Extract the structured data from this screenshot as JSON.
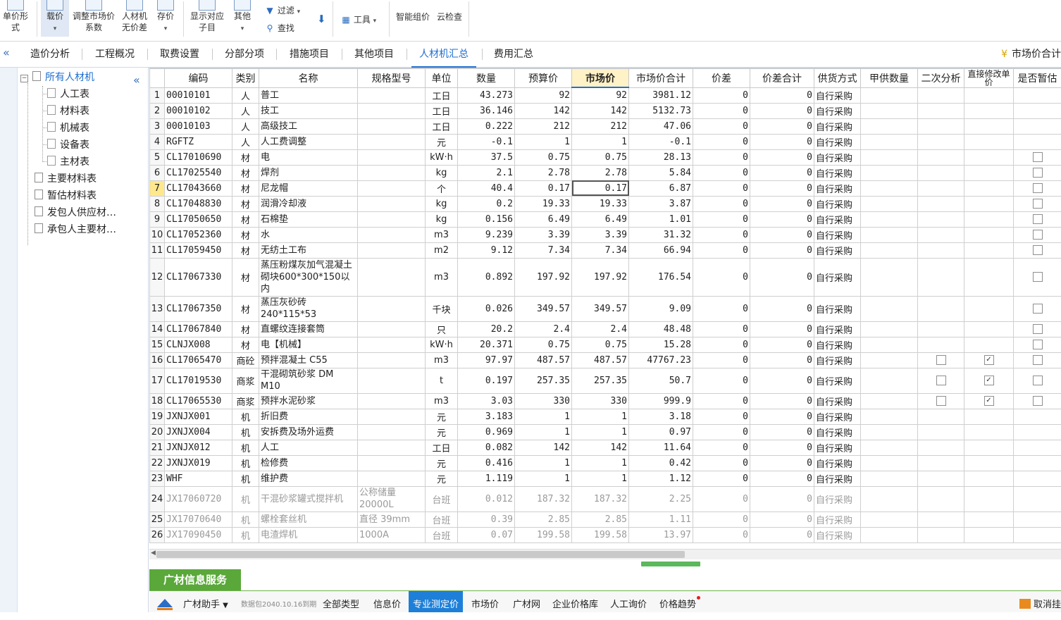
{
  "ribbon": {
    "unit_price_form": "单价形式",
    "zaijia": "载价",
    "adjust_market_1": "调整市场价",
    "adjust_market_2": "系数",
    "rcj_nodiff_1": "人材机",
    "rcj_nodiff_2": "无价差",
    "save_price": "存价",
    "show_sub_1": "显示对应",
    "show_sub_2": "子目",
    "other": "其他",
    "filter": "过滤",
    "find": "查找",
    "tools": "工具",
    "smart_price": "智能组价",
    "cloud_check": "云检查"
  },
  "tabs": {
    "items": [
      "造价分析",
      "工程概况",
      "取费设置",
      "分部分项",
      "措施项目",
      "其他项目",
      "人材机汇总",
      "费用汇总"
    ],
    "active": "人材机汇总",
    "market_total": "市场价合计"
  },
  "tree": {
    "root": "所有人材机",
    "children": [
      "人工表",
      "材料表",
      "机械表",
      "设备表",
      "主材表"
    ],
    "groups": [
      "主要材料表",
      "暂估材料表",
      "发包人供应材…",
      "承包人主要材…"
    ]
  },
  "grid": {
    "columns": [
      "编码",
      "类别",
      "名称",
      "规格型号",
      "单位",
      "数量",
      "预算价",
      "市场价",
      "市场价合计",
      "价差",
      "价差合计",
      "供货方式",
      "甲供数量",
      "二次分析",
      "直接修改单价",
      "是否暂估"
    ],
    "rows": [
      {
        "n": "1",
        "code": "00010101",
        "cat": "人",
        "name": "普工",
        "spec": "",
        "unit": "工日",
        "qty": "43.273",
        "budget": "92",
        "market": "92",
        "total": "3981.12",
        "diff": "0",
        "difft": "0",
        "supply": "自行采购",
        "a2": null,
        "direct": null,
        "temp": null
      },
      {
        "n": "2",
        "code": "00010102",
        "cat": "人",
        "name": "技工",
        "spec": "",
        "unit": "工日",
        "qty": "36.146",
        "budget": "142",
        "market": "142",
        "total": "5132.73",
        "diff": "0",
        "difft": "0",
        "supply": "自行采购",
        "a2": null,
        "direct": null,
        "temp": null
      },
      {
        "n": "3",
        "code": "00010103",
        "cat": "人",
        "name": "高级技工",
        "spec": "",
        "unit": "工日",
        "qty": "0.222",
        "budget": "212",
        "market": "212",
        "total": "47.06",
        "diff": "0",
        "difft": "0",
        "supply": "自行采购",
        "a2": null,
        "direct": null,
        "temp": null
      },
      {
        "n": "4",
        "code": "RGFTZ",
        "cat": "人",
        "name": "人工费调整",
        "spec": "",
        "unit": "元",
        "qty": "-0.1",
        "budget": "1",
        "market": "1",
        "total": "-0.1",
        "diff": "0",
        "difft": "0",
        "supply": "自行采购",
        "a2": null,
        "direct": null,
        "temp": null
      },
      {
        "n": "5",
        "code": "CL17010690",
        "cat": "材",
        "name": "电",
        "spec": "",
        "unit": "kW·h",
        "qty": "37.5",
        "budget": "0.75",
        "market": "0.75",
        "total": "28.13",
        "diff": "0",
        "difft": "0",
        "supply": "自行采购",
        "a2": null,
        "direct": null,
        "temp": false
      },
      {
        "n": "6",
        "code": "CL17025540",
        "cat": "材",
        "name": "焊剂",
        "spec": "",
        "unit": "kg",
        "qty": "2.1",
        "budget": "2.78",
        "market": "2.78",
        "total": "5.84",
        "diff": "0",
        "difft": "0",
        "supply": "自行采购",
        "a2": null,
        "direct": null,
        "temp": false
      },
      {
        "n": "7",
        "code": "CL17043660",
        "cat": "材",
        "name": "尼龙帽",
        "spec": "",
        "unit": "个",
        "qty": "40.4",
        "budget": "0.17",
        "market": "0.17",
        "total": "6.87",
        "diff": "0",
        "difft": "0",
        "supply": "自行采购",
        "a2": null,
        "direct": null,
        "temp": false,
        "current": true
      },
      {
        "n": "8",
        "code": "CL17048830",
        "cat": "材",
        "name": "润滑冷却液",
        "spec": "",
        "unit": "kg",
        "qty": "0.2",
        "budget": "19.33",
        "market": "19.33",
        "total": "3.87",
        "diff": "0",
        "difft": "0",
        "supply": "自行采购",
        "a2": null,
        "direct": null,
        "temp": false
      },
      {
        "n": "9",
        "code": "CL17050650",
        "cat": "材",
        "name": "石棉垫",
        "spec": "",
        "unit": "kg",
        "qty": "0.156",
        "budget": "6.49",
        "market": "6.49",
        "total": "1.01",
        "diff": "0",
        "difft": "0",
        "supply": "自行采购",
        "a2": null,
        "direct": null,
        "temp": false
      },
      {
        "n": "10",
        "code": "CL17052360",
        "cat": "材",
        "name": "水",
        "spec": "",
        "unit": "m3",
        "qty": "9.239",
        "budget": "3.39",
        "market": "3.39",
        "total": "31.32",
        "diff": "0",
        "difft": "0",
        "supply": "自行采购",
        "a2": null,
        "direct": null,
        "temp": false
      },
      {
        "n": "11",
        "code": "CL17059450",
        "cat": "材",
        "name": "无纺土工布",
        "spec": "",
        "unit": "m2",
        "qty": "9.12",
        "budget": "7.34",
        "market": "7.34",
        "total": "66.94",
        "diff": "0",
        "difft": "0",
        "supply": "自行采购",
        "a2": null,
        "direct": null,
        "temp": false
      },
      {
        "n": "12",
        "code": "CL17067330",
        "cat": "材",
        "name": "蒸压粉煤灰加气混凝土砌块600*300*150以内",
        "spec": "",
        "unit": "m3",
        "qty": "0.892",
        "budget": "197.92",
        "market": "197.92",
        "total": "176.54",
        "diff": "0",
        "difft": "0",
        "supply": "自行采购",
        "a2": null,
        "direct": null,
        "temp": false
      },
      {
        "n": "13",
        "code": "CL17067350",
        "cat": "材",
        "name": "蒸压灰砂砖240*115*53",
        "spec": "",
        "unit": "千块",
        "qty": "0.026",
        "budget": "349.57",
        "market": "349.57",
        "total": "9.09",
        "diff": "0",
        "difft": "0",
        "supply": "自行采购",
        "a2": null,
        "direct": null,
        "temp": false
      },
      {
        "n": "14",
        "code": "CL17067840",
        "cat": "材",
        "name": "直螺纹连接套筒",
        "spec": "",
        "unit": "只",
        "qty": "20.2",
        "budget": "2.4",
        "market": "2.4",
        "total": "48.48",
        "diff": "0",
        "difft": "0",
        "supply": "自行采购",
        "a2": null,
        "direct": null,
        "temp": false
      },
      {
        "n": "15",
        "code": "CLNJX008",
        "cat": "材",
        "name": "电【机械】",
        "spec": "",
        "unit": "kW·h",
        "qty": "20.371",
        "budget": "0.75",
        "market": "0.75",
        "total": "15.28",
        "diff": "0",
        "difft": "0",
        "supply": "自行采购",
        "a2": null,
        "direct": null,
        "temp": false
      },
      {
        "n": "16",
        "code": "CL17065470",
        "cat": "商砼",
        "name": "预拌混凝土 C55",
        "spec": "",
        "unit": "m3",
        "qty": "97.97",
        "budget": "487.57",
        "market": "487.57",
        "total": "47767.23",
        "diff": "0",
        "difft": "0",
        "supply": "自行采购",
        "a2": false,
        "direct": true,
        "temp": false
      },
      {
        "n": "17",
        "code": "CL17019530",
        "cat": "商浆",
        "name": "干混砌筑砂浆 DM M10",
        "spec": "",
        "unit": "t",
        "qty": "0.197",
        "budget": "257.35",
        "market": "257.35",
        "total": "50.7",
        "diff": "0",
        "difft": "0",
        "supply": "自行采购",
        "a2": false,
        "direct": true,
        "temp": false
      },
      {
        "n": "18",
        "code": "CL17065530",
        "cat": "商浆",
        "name": "预拌水泥砂浆",
        "spec": "",
        "unit": "m3",
        "qty": "3.03",
        "budget": "330",
        "market": "330",
        "total": "999.9",
        "diff": "0",
        "difft": "0",
        "supply": "自行采购",
        "a2": false,
        "direct": true,
        "temp": false
      },
      {
        "n": "19",
        "code": "JXNJX001",
        "cat": "机",
        "name": "折旧费",
        "spec": "",
        "unit": "元",
        "qty": "3.183",
        "budget": "1",
        "market": "1",
        "total": "3.18",
        "diff": "0",
        "difft": "0",
        "supply": "自行采购",
        "a2": null,
        "direct": null,
        "temp": null
      },
      {
        "n": "20",
        "code": "JXNJX004",
        "cat": "机",
        "name": "安拆费及场外运费",
        "spec": "",
        "unit": "元",
        "qty": "0.969",
        "budget": "1",
        "market": "1",
        "total": "0.97",
        "diff": "0",
        "difft": "0",
        "supply": "自行采购",
        "a2": null,
        "direct": null,
        "temp": null
      },
      {
        "n": "21",
        "code": "JXNJX012",
        "cat": "机",
        "name": "人工",
        "spec": "",
        "unit": "工日",
        "qty": "0.082",
        "budget": "142",
        "market": "142",
        "total": "11.64",
        "diff": "0",
        "difft": "0",
        "supply": "自行采购",
        "a2": null,
        "direct": null,
        "temp": null
      },
      {
        "n": "22",
        "code": "JXNJX019",
        "cat": "机",
        "name": "检修费",
        "spec": "",
        "unit": "元",
        "qty": "0.416",
        "budget": "1",
        "market": "1",
        "total": "0.42",
        "diff": "0",
        "difft": "0",
        "supply": "自行采购",
        "a2": null,
        "direct": null,
        "temp": null
      },
      {
        "n": "23",
        "code": "WHF",
        "cat": "机",
        "name": "维护费",
        "spec": "",
        "unit": "元",
        "qty": "1.119",
        "budget": "1",
        "market": "1",
        "total": "1.12",
        "diff": "0",
        "difft": "0",
        "supply": "自行采购",
        "a2": null,
        "direct": null,
        "temp": null
      },
      {
        "n": "24",
        "code": "JX17060720",
        "cat": "机",
        "name": "干混砂浆罐式搅拌机",
        "spec": "公称储量20000L",
        "unit": "台班",
        "qty": "0.012",
        "budget": "187.32",
        "market": "187.32",
        "total": "2.25",
        "diff": "0",
        "difft": "0",
        "supply": "自行采购",
        "a2": null,
        "direct": null,
        "temp": null,
        "grey": true
      },
      {
        "n": "25",
        "code": "JX17070640",
        "cat": "机",
        "name": "螺栓套丝机",
        "spec": "直径 39mm",
        "unit": "台班",
        "qty": "0.39",
        "budget": "2.85",
        "market": "2.85",
        "total": "1.11",
        "diff": "0",
        "difft": "0",
        "supply": "自行采购",
        "a2": null,
        "direct": null,
        "temp": null,
        "grey": true
      },
      {
        "n": "26",
        "code": "JX17090450",
        "cat": "机",
        "name": "电渣焊机",
        "spec": "1000A",
        "unit": "台班",
        "qty": "0.07",
        "budget": "199.58",
        "market": "199.58",
        "total": "13.97",
        "diff": "0",
        "difft": "0",
        "supply": "自行采购",
        "a2": null,
        "direct": null,
        "temp": null,
        "grey": true
      }
    ]
  },
  "service": {
    "tab": "广材信息服务",
    "helper": "广材助手",
    "package": "数据包2040.10.16到期",
    "items": [
      "全部类型",
      "信息价",
      "专业测定价",
      "市场价",
      "广材网",
      "企业价格库",
      "人工询价",
      "价格趋势"
    ],
    "active": "专业测定价",
    "cancel": "取消挂"
  },
  "colors": {
    "accent": "#1f6fd0",
    "service_green": "#5aa83a",
    "market_header": "#fff2c6"
  }
}
